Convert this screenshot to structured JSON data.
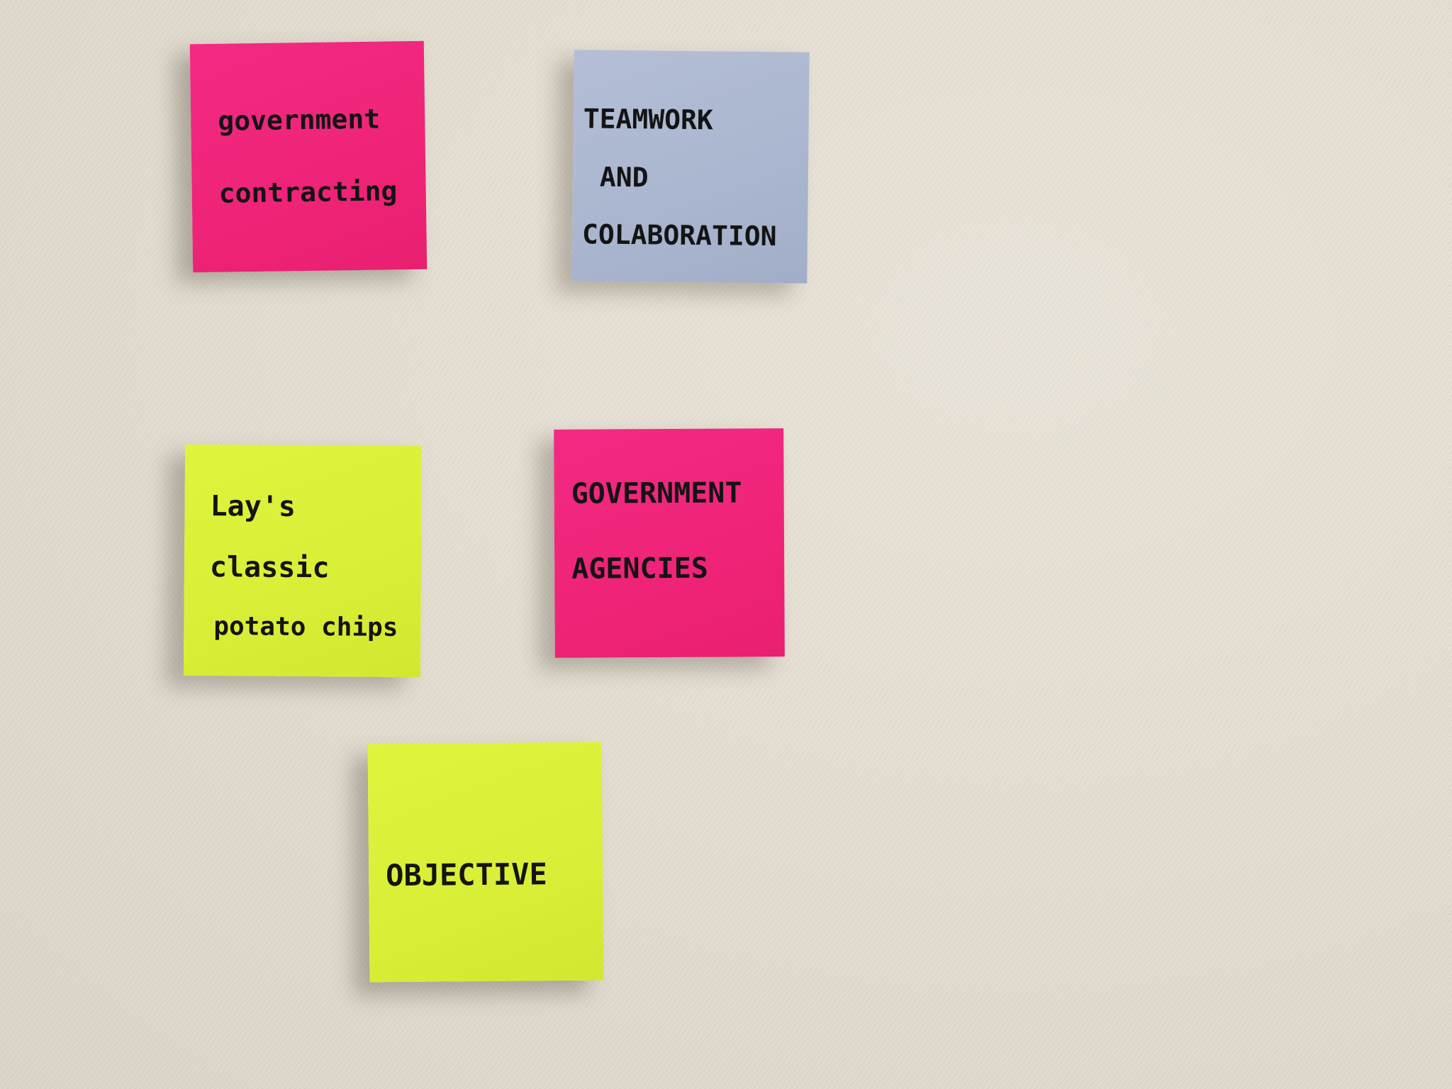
{
  "notes": [
    {
      "id": "note-1",
      "color": "#f02a80",
      "lines": [
        "government",
        "contracting"
      ]
    },
    {
      "id": "note-2",
      "color": "#adb8d0",
      "lines": [
        "TEAMWORK",
        "AND",
        "COLABORATION"
      ]
    },
    {
      "id": "note-3",
      "color": "#dcf23a",
      "lines": [
        "Lay's",
        "classic",
        "potato chips"
      ]
    },
    {
      "id": "note-4",
      "color": "#f02a80",
      "lines": [
        "GOVERNMENT",
        "AGENCIES"
      ]
    },
    {
      "id": "note-5",
      "color": "#dcf23a",
      "lines": [
        "OBJECTIVE"
      ]
    }
  ]
}
